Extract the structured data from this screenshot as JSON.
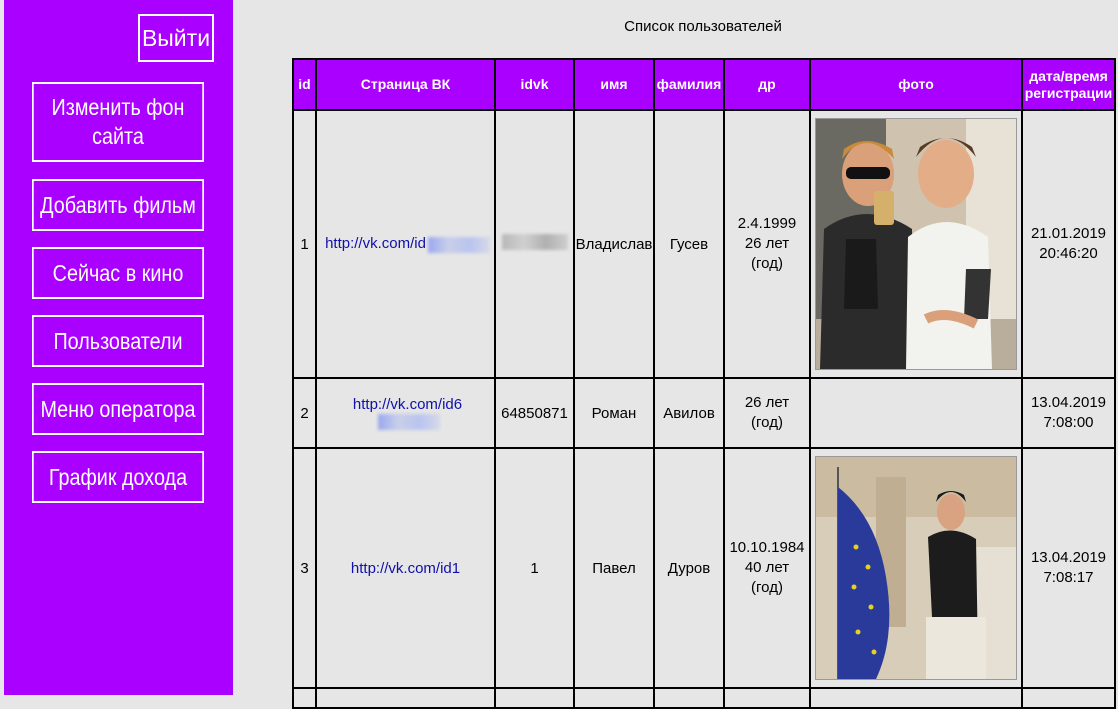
{
  "sidebar": {
    "logout_label": "Выйти",
    "items": [
      {
        "label": "Изменить фон сайта"
      },
      {
        "label": "Добавить фильм"
      },
      {
        "label": "Сейчас в кино"
      },
      {
        "label": "Пользователи"
      },
      {
        "label": "Меню оператора"
      },
      {
        "label": "График дохода"
      }
    ]
  },
  "page": {
    "title": "Список пользователей"
  },
  "table": {
    "headers": [
      "id",
      "Страница ВК",
      "idvk",
      "имя",
      "фамилия",
      "др",
      "фото",
      "дата/время регистрации"
    ],
    "rows": [
      {
        "id": "1",
        "vk": "http://vk.com/id",
        "idvk": "",
        "name": "Владислав",
        "surname": "Гусев",
        "birth": "2.4.1999\n26 лет\n(год)",
        "photo_icon": "photo-two-men-selfie",
        "registered": "21.01.2019\n20:46:20"
      },
      {
        "id": "2",
        "vk": "http://vk.com/id6",
        "idvk": "64850871",
        "name": "Роман",
        "surname": "Авилов",
        "birth": "26 лет\n(год)",
        "photo_icon": "",
        "registered": "13.04.2019\n7:08:00"
      },
      {
        "id": "3",
        "vk": "http://vk.com/id1",
        "idvk": "1",
        "name": "Павел",
        "surname": "Дуров",
        "birth": "10.10.1984\n40 лет\n(год)",
        "photo_icon": "photo-man-with-eu-flag",
        "registered": "13.04.2019\n7:08:17"
      }
    ]
  },
  "colors": {
    "accent": "#aa00ff",
    "background": "#e6e6e6",
    "link": "#1010aa"
  }
}
